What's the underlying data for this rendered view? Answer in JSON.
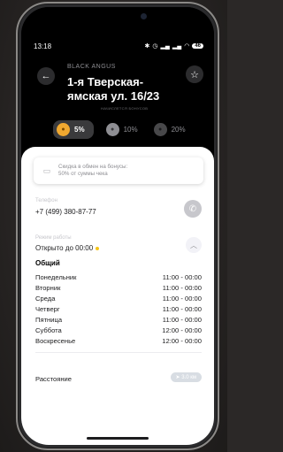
{
  "status_bar": {
    "time": "13:18",
    "icons": [
      "bluetooth-icon",
      "alarm-icon",
      "signal-icon",
      "signal-icon",
      "wifi-icon"
    ],
    "battery": "46"
  },
  "header": {
    "brand": "BLACK ANGUS",
    "title": "1-я Тверская-ямская ул. 16/23",
    "bonus_caption": "НАЧИСЛЕТСЯ БОНУСОВ",
    "tiers": [
      {
        "percent": "5%",
        "active": true,
        "color": "#f0a830"
      },
      {
        "percent": "10%",
        "active": false,
        "color": "#8e8e93"
      },
      {
        "percent": "20%",
        "active": false,
        "color": "#48484a"
      }
    ]
  },
  "promo": {
    "line1": "Скидка в обмен на бонусы:",
    "line2": "50% от суммы чека"
  },
  "phone": {
    "label": "Телефон",
    "value": "+7 (499) 380-87-77"
  },
  "hours": {
    "label": "Режим работы",
    "status": "Открыто до 00:00",
    "section_title": "Общий",
    "schedule": [
      {
        "day": "Понедельник",
        "time": "11:00 - 00:00"
      },
      {
        "day": "Вторник",
        "time": "11:00 - 00:00"
      },
      {
        "day": "Среда",
        "time": "11:00 - 00:00"
      },
      {
        "day": "Четверг",
        "time": "11:00 - 00:00"
      },
      {
        "day": "Пятница",
        "time": "11:00 - 00:00"
      },
      {
        "day": "Суббота",
        "time": "12:00 - 00:00"
      },
      {
        "day": "Воскресенье",
        "time": "12:00 - 00:00"
      }
    ]
  },
  "distance": {
    "label": "Расстояние",
    "value": "3.0 км"
  }
}
